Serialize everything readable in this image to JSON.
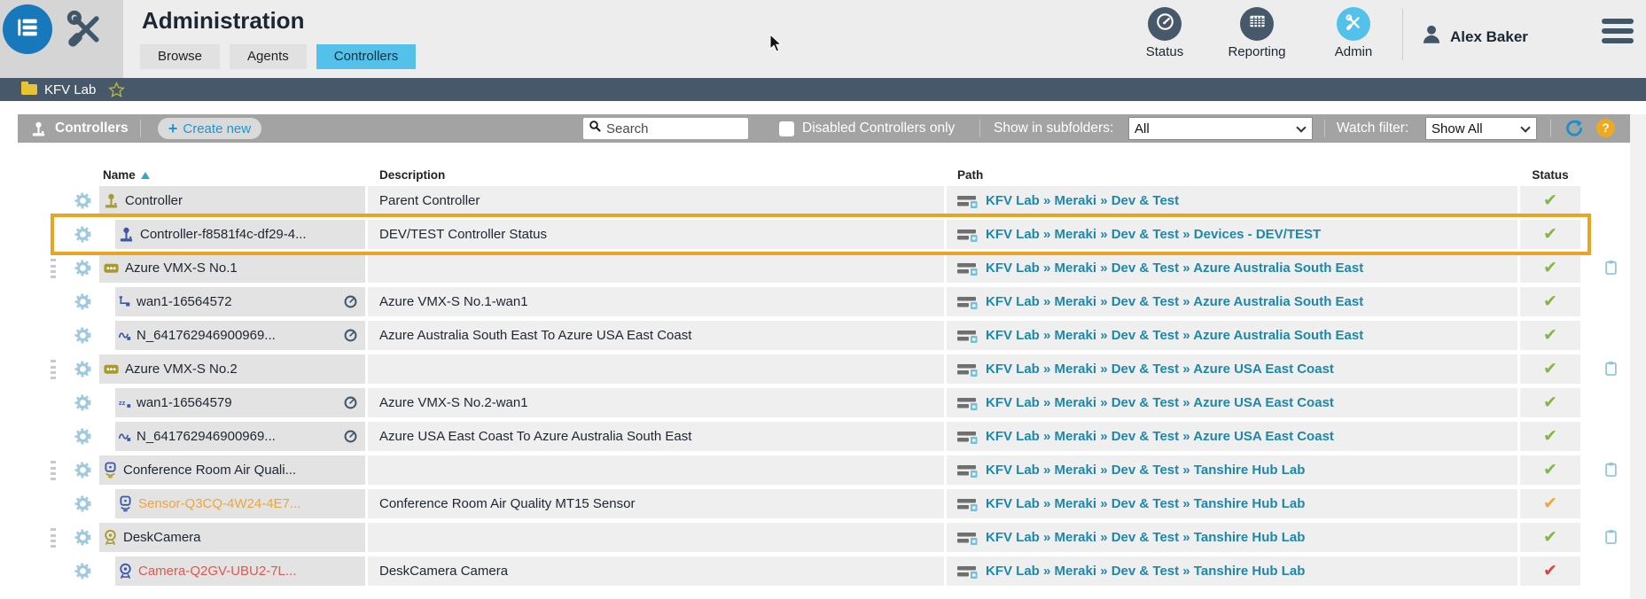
{
  "app": {
    "title": "Administration",
    "tabs": [
      {
        "label": "Browse",
        "active": false
      },
      {
        "label": "Agents",
        "active": false
      },
      {
        "label": "Controllers",
        "active": true
      }
    ],
    "nav": [
      {
        "label": "Status",
        "icon": "status-gauge-icon",
        "active": false
      },
      {
        "label": "Reporting",
        "icon": "reporting-table-icon",
        "active": false
      },
      {
        "label": "Admin",
        "icon": "admin-tools-icon",
        "active": true
      }
    ],
    "user_name": "Alex Baker"
  },
  "breadcrumb": {
    "folder": "KFV Lab"
  },
  "toolbar": {
    "section_label": "Controllers",
    "create_button": "Create new",
    "create_plus": "+",
    "search_placeholder": "Search",
    "checkbox_label": "Disabled Controllers only",
    "subfolders_label": "Show in subfolders:",
    "subfolders_value": "All",
    "watch_label": "Watch filter:",
    "watch_value": "Show All",
    "help_label": "?"
  },
  "table": {
    "columns": {
      "name": "Name",
      "description": "Description",
      "path": "Path",
      "status": "Status"
    },
    "sorted_by": "Name",
    "rows": [
      {
        "name": "Controller",
        "icon": "joystick",
        "color": "olive",
        "level": 0,
        "handle": false,
        "gauge": false,
        "desc": "Parent Controller",
        "path": "KFV Lab » Meraki » Dev & Test",
        "status": "ok",
        "copy": false,
        "highlighted": false
      },
      {
        "name": "Controller-f8581f4c-df29-4...",
        "icon": "joystick",
        "color": "blue",
        "level": 1,
        "handle": false,
        "gauge": false,
        "desc": "DEV/TEST Controller Status",
        "path": "KFV Lab » Meraki » Dev & Test » Devices - DEV/TEST",
        "status": "ok",
        "copy": false,
        "highlighted": true
      },
      {
        "name": "Azure VMX-S No.1",
        "icon": "device",
        "color": "olive",
        "level": 0,
        "handle": true,
        "gauge": false,
        "desc": "",
        "path": "KFV Lab » Meraki » Dev & Test » Azure Australia South East",
        "status": "ok",
        "copy": true,
        "highlighted": false
      },
      {
        "name": "wan1-16564572",
        "icon": "elbow",
        "color": "blue",
        "level": 1,
        "handle": false,
        "gauge": true,
        "desc": "Azure VMX-S No.1-wan1",
        "path": "KFV Lab » Meraki » Dev & Test » Azure Australia South East",
        "status": "ok",
        "copy": false,
        "highlighted": false
      },
      {
        "name": "N_641762946900969...",
        "icon": "wave",
        "color": "blue",
        "level": 1,
        "handle": false,
        "gauge": true,
        "desc": "Azure Australia South East To Azure USA East Coast",
        "path": "KFV Lab » Meraki » Dev & Test » Azure Australia South East",
        "status": "ok",
        "copy": false,
        "highlighted": false
      },
      {
        "name": "Azure VMX-S No.2",
        "icon": "device",
        "color": "olive",
        "level": 0,
        "handle": true,
        "gauge": false,
        "desc": "",
        "path": "KFV Lab » Meraki » Dev & Test » Azure USA East Coast",
        "status": "ok",
        "copy": true,
        "highlighted": false
      },
      {
        "name": "wan1-16564579",
        "icon": "zz",
        "color": "blue",
        "level": 1,
        "handle": false,
        "gauge": true,
        "desc": "Azure VMX-S No.2-wan1",
        "path": "KFV Lab » Meraki » Dev & Test » Azure USA East Coast",
        "status": "ok",
        "copy": false,
        "highlighted": false
      },
      {
        "name": "N_641762946900969...",
        "icon": "wave",
        "color": "blue",
        "level": 1,
        "handle": false,
        "gauge": true,
        "desc": "Azure USA East Coast To Azure Australia South East",
        "path": "KFV Lab » Meraki » Dev & Test » Azure USA East Coast",
        "status": "ok",
        "copy": false,
        "highlighted": false
      },
      {
        "name": "Conference Room Air Quali...",
        "icon": "sensor-group",
        "color": "blue",
        "level": 0,
        "handle": true,
        "gauge": false,
        "desc": "",
        "path": "KFV Lab » Meraki » Dev & Test » Tanshire Hub Lab",
        "status": "ok",
        "copy": true,
        "highlighted": false
      },
      {
        "name": "Sensor-Q3CQ-4W24-4E7...",
        "icon": "sensor",
        "color": "blue",
        "level": 1,
        "handle": false,
        "gauge": false,
        "desc": "Conference Room Air Quality MT15 Sensor",
        "path": "KFV Lab » Meraki » Dev & Test » Tanshire Hub Lab",
        "status": "warn",
        "copy": false,
        "highlighted": false,
        "name_color": "#eea43f"
      },
      {
        "name": "DeskCamera",
        "icon": "camera",
        "color": "olive",
        "level": 0,
        "handle": true,
        "gauge": false,
        "desc": "",
        "path": "KFV Lab » Meraki » Dev & Test » Tanshire Hub Lab",
        "status": "ok",
        "copy": true,
        "highlighted": false
      },
      {
        "name": "Camera-Q2GV-UBU2-7L...",
        "icon": "camera",
        "color": "blue",
        "level": 1,
        "handle": false,
        "gauge": false,
        "desc": "DeskCamera Camera",
        "path": "KFV Lab » Meraki » Dev & Test » Tanshire Hub Lab",
        "status": "err",
        "copy": false,
        "highlighted": false,
        "name_color": "#e0574e"
      }
    ]
  },
  "colors": {
    "accent_blue": "#53c1e9",
    "link": "#1e87ab",
    "ok": "#84b642",
    "warning": "#f2a735",
    "error": "#d8453e",
    "highlight": "#eba421",
    "icon_olive": "#a79b2e",
    "icon_blue": "#3d58ab"
  }
}
